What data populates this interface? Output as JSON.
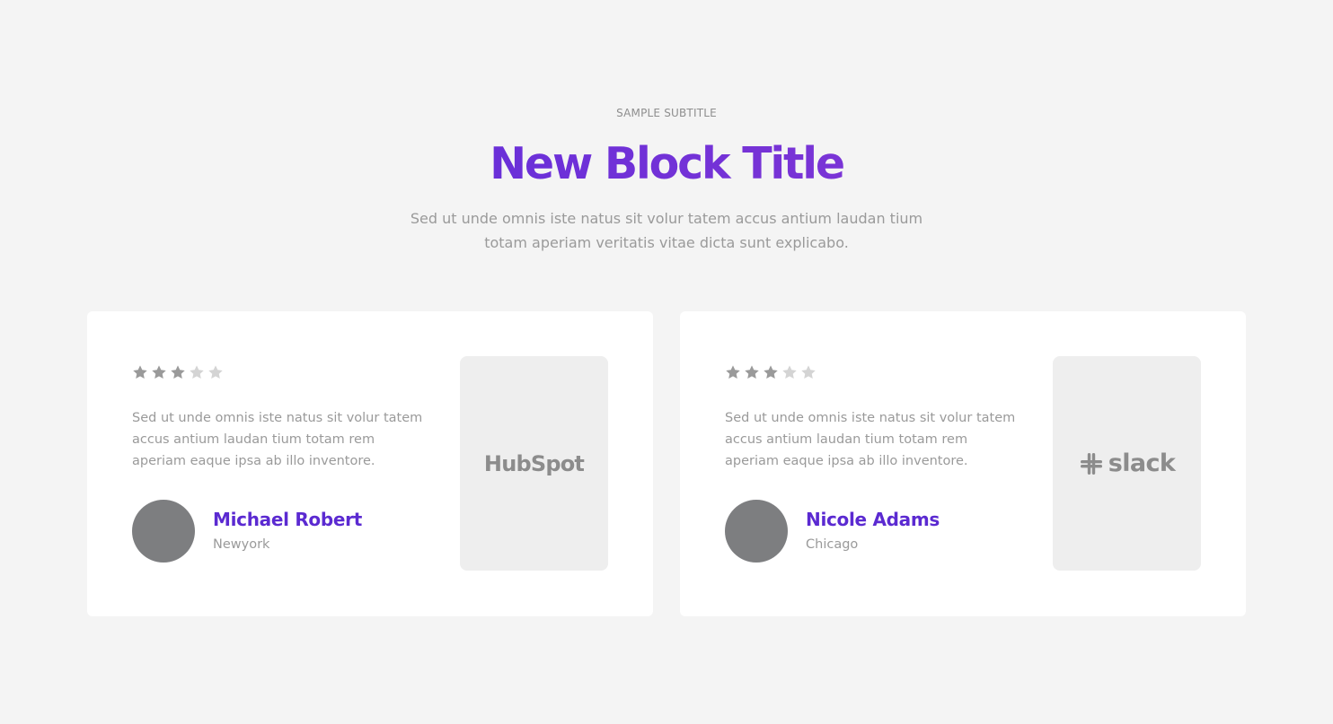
{
  "section": {
    "subtitle": "SAMPLE SUBTITLE",
    "title": "New Block Title",
    "description_line1": "Sed ut unde omnis iste natus sit volur tatem accus antium laudan tium",
    "description_line2": "totam aperiam veritatis vitae dicta sunt explicabo."
  },
  "colors": {
    "background": "#f4f4f4",
    "title_gradient_start": "#6a2fd8",
    "title_gradient_end": "#7a34d6",
    "name_color": "#5b2ad1",
    "star_active": "#9a9a9a",
    "star_inactive": "#d4d4d4",
    "avatar": "#7d7e80"
  },
  "testimonials": [
    {
      "rating": 3,
      "max_rating": 5,
      "quote": "Sed ut unde omnis iste natus sit volur tatem accus antium laudan tium totam rem aperiam eaque ipsa ab illo inventore.",
      "name": "Michael Robert",
      "location": "Newyork",
      "logo": {
        "brand_text": "HubSpot",
        "icon": "hubspot-logo"
      }
    },
    {
      "rating": 3,
      "max_rating": 5,
      "quote": "Sed ut unde omnis iste natus sit volur tatem accus antium laudan tium totam rem aperiam eaque ipsa ab illo inventore.",
      "name": "Nicole Adams",
      "location": "Chicago",
      "logo": {
        "brand_text": "slack",
        "icon": "slack-logo"
      }
    }
  ]
}
